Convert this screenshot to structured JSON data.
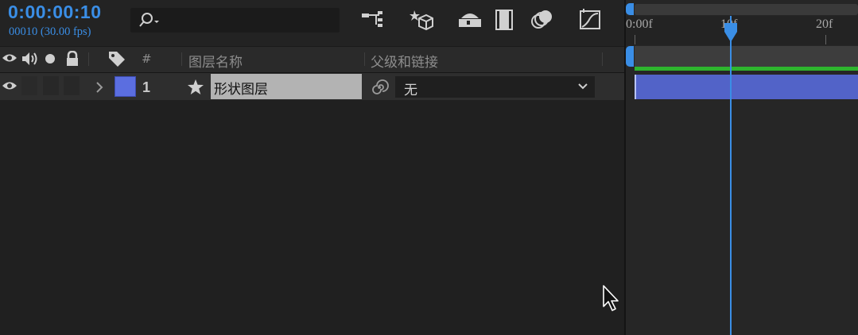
{
  "comp": {
    "timecode": "0:00:00:10",
    "frame_info": "00010 (30.00 fps)"
  },
  "toolbar": {
    "search_placeholder": "",
    "tools": [
      "composition-flowchart-icon",
      "draft-3d-icon",
      "shy-layers-icon",
      "frame-blending-icon",
      "motion-blur-icon",
      "graph-editor-icon"
    ]
  },
  "columns": {
    "hash": "#",
    "layer_name": "图层名称",
    "parent_link": "父级和链接"
  },
  "layers": [
    {
      "number": "1",
      "name": "形状图层",
      "parent": "无",
      "label_color": "#5b6ee0"
    }
  ],
  "timeline": {
    "ruler_labels": [
      "0:00f",
      "10f",
      "20f"
    ],
    "current_frame": 10
  },
  "colors": {
    "accent": "#3a8ee6",
    "work_area_green": "#2eb52e",
    "layer_bar": "#5263c8"
  }
}
